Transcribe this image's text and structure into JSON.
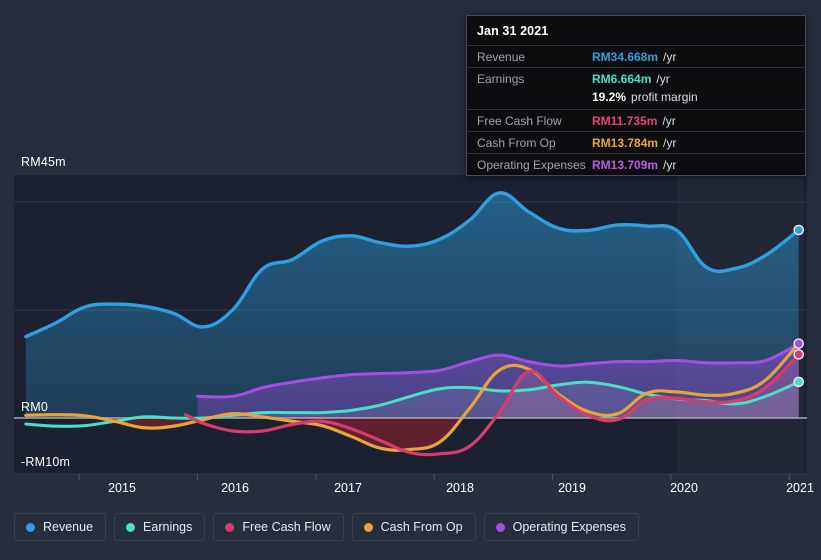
{
  "chart_data": {
    "type": "area",
    "title": "",
    "currency_prefix": "RM",
    "xlabel": "",
    "ylabel": "",
    "ylim": [
      -13,
      45
    ],
    "y_ticks": [
      {
        "label": "RM45m",
        "value": 45
      },
      {
        "label": "RM0",
        "value": 0
      },
      {
        "label": "-RM10m",
        "value": -10
      }
    ],
    "x_ticks": [
      "2015",
      "2016",
      "2017",
      "2018",
      "2019",
      "2020",
      "2021"
    ],
    "x_range": [
      "2014-07",
      "2021-04"
    ],
    "grid": true,
    "legend_position": "bottom-left",
    "series": [
      {
        "name": "Revenue",
        "color": "#2e9fe0",
        "fill": true,
        "x": [
          2014.55,
          2014.8,
          2015.05,
          2015.3,
          2015.55,
          2015.8,
          2016.05,
          2016.3,
          2016.55,
          2016.8,
          2017.05,
          2017.3,
          2017.55,
          2017.8,
          2018.05,
          2018.3,
          2018.55,
          2018.8,
          2019.05,
          2019.3,
          2019.55,
          2019.8,
          2020.05,
          2020.3,
          2020.55,
          2020.8,
          2021.08
        ],
        "values": [
          15.0,
          17.5,
          20.5,
          21.0,
          20.6,
          19.3,
          16.8,
          20.0,
          27.5,
          29.2,
          32.6,
          33.6,
          32.3,
          31.7,
          33.0,
          36.5,
          41.5,
          38.0,
          35.0,
          34.6,
          35.6,
          35.4,
          34.6,
          27.8,
          27.6,
          30.0,
          34.668
        ]
      },
      {
        "name": "Earnings",
        "color": "#49e0c4",
        "fill": false,
        "x": [
          2014.55,
          2014.8,
          2015.05,
          2015.3,
          2015.55,
          2015.8,
          2016.05,
          2016.3,
          2016.55,
          2016.8,
          2017.05,
          2017.3,
          2017.55,
          2017.8,
          2018.05,
          2018.3,
          2018.55,
          2018.8,
          2019.05,
          2019.3,
          2019.55,
          2019.8,
          2020.05,
          2020.3,
          2020.55,
          2020.8,
          2021.08
        ],
        "values": [
          -1.1,
          -1.5,
          -1.4,
          -0.6,
          0.2,
          0.0,
          0.0,
          0.5,
          1.0,
          1.0,
          1.0,
          1.4,
          2.4,
          4.0,
          5.4,
          5.6,
          5.0,
          5.2,
          6.1,
          6.6,
          5.8,
          4.4,
          3.5,
          3.2,
          2.6,
          4.0,
          6.664
        ]
      },
      {
        "name": "Free Cash Flow",
        "color": "#d63c6d",
        "fill": false,
        "x": [
          2015.9,
          2016.05,
          2016.3,
          2016.55,
          2016.8,
          2017.05,
          2017.3,
          2017.55,
          2017.8,
          2018.05,
          2018.3,
          2018.55,
          2018.8,
          2019.05,
          2019.3,
          2019.55,
          2019.8,
          2020.05,
          2020.3,
          2020.55,
          2020.8,
          2021.08
        ],
        "values": [
          0.6,
          -1.0,
          -2.4,
          -2.4,
          -1.2,
          -0.6,
          -2.0,
          -4.2,
          -6.4,
          -6.6,
          -5.2,
          1.0,
          8.6,
          4.0,
          0.5,
          -0.3,
          3.4,
          3.6,
          3.0,
          3.2,
          5.6,
          11.735
        ]
      },
      {
        "name": "Cash From Op",
        "color": "#e8a33d",
        "fill": false,
        "x": [
          2014.55,
          2014.8,
          2015.05,
          2015.3,
          2015.55,
          2015.8,
          2016.05,
          2016.3,
          2016.55,
          2016.8,
          2017.05,
          2017.3,
          2017.55,
          2017.8,
          2018.05,
          2018.3,
          2018.55,
          2018.8,
          2019.05,
          2019.3,
          2019.55,
          2019.8,
          2020.05,
          2020.3,
          2020.55,
          2020.8,
          2021.08
        ],
        "values": [
          0.5,
          0.6,
          0.4,
          -0.6,
          -1.8,
          -1.5,
          -0.3,
          0.8,
          0.2,
          -0.6,
          -1.4,
          -3.4,
          -5.6,
          -5.8,
          -4.4,
          1.8,
          8.8,
          9.0,
          4.4,
          1.2,
          0.8,
          4.6,
          4.8,
          4.2,
          4.6,
          7.0,
          13.784
        ]
      },
      {
        "name": "Operating Expenses",
        "color": "#a84ce8",
        "fill": true,
        "x": [
          2016.0,
          2016.3,
          2016.55,
          2016.8,
          2017.05,
          2017.3,
          2017.55,
          2017.8,
          2018.05,
          2018.3,
          2018.55,
          2018.8,
          2019.05,
          2019.3,
          2019.55,
          2019.8,
          2020.05,
          2020.3,
          2020.55,
          2020.8,
          2021.08
        ],
        "values": [
          4.0,
          4.0,
          5.6,
          6.6,
          7.4,
          8.0,
          8.2,
          8.4,
          8.8,
          10.4,
          11.6,
          10.4,
          9.6,
          10.0,
          10.4,
          10.4,
          10.6,
          10.2,
          10.2,
          10.6,
          13.709
        ]
      }
    ],
    "highlight_band": {
      "from": 2020.05,
      "to": 2021.12,
      "label": ""
    }
  },
  "tooltip": {
    "visible": true,
    "title": "Jan 31 2021",
    "rows": [
      {
        "key": "Revenue",
        "value": "RM34.668m",
        "unit": "/yr",
        "color": "#2e9fe0"
      },
      {
        "key": "Earnings",
        "value": "RM6.664m",
        "unit": "/yr",
        "color": "#49e0c4"
      },
      {
        "key": "",
        "value": "19.2%",
        "unit": "profit margin",
        "color": "#ffffff",
        "sub": true
      },
      {
        "key": "Free Cash Flow",
        "value": "RM11.735m",
        "unit": "/yr",
        "color": "#e8437e"
      },
      {
        "key": "Cash From Op",
        "value": "RM13.784m",
        "unit": "/yr",
        "color": "#e8a33d"
      },
      {
        "key": "Operating Expenses",
        "value": "RM13.709m",
        "unit": "/yr",
        "color": "#b85ce8"
      }
    ]
  },
  "legend": {
    "items": [
      {
        "label": "Revenue",
        "color": "#2e9fe0"
      },
      {
        "label": "Earnings",
        "color": "#49e0c4"
      },
      {
        "label": "Free Cash Flow",
        "color": "#d63c6d"
      },
      {
        "label": "Cash From Op",
        "color": "#e8a33d"
      },
      {
        "label": "Operating Expenses",
        "color": "#a84ce8"
      }
    ]
  },
  "theme": {
    "background": "#262e3e",
    "plot_background": "#1b2130",
    "grid_color": "#333b4b",
    "zero_line_color": "#b9bcc4",
    "tooltip_background": "#0d0d0f",
    "tooltip_border": "#4a4a52",
    "axis_text": "#ffffff"
  }
}
